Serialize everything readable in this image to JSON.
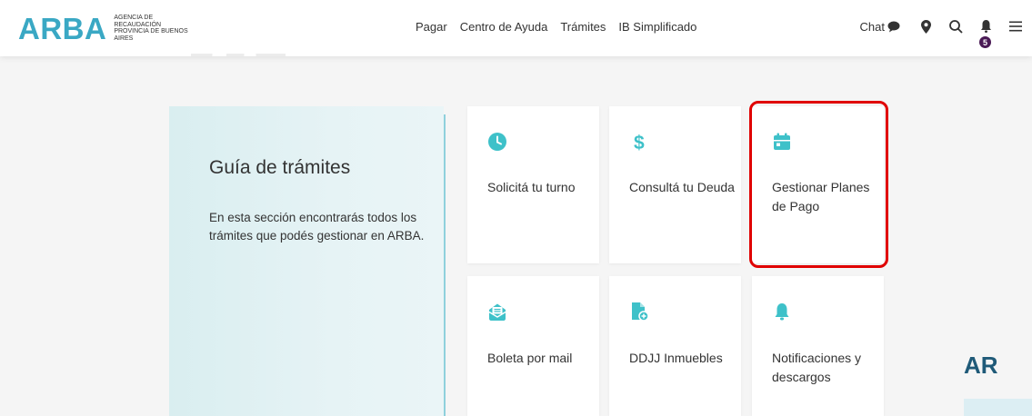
{
  "header": {
    "logo": {
      "mark": "ARBA",
      "sub": [
        "AGENCIA DE",
        "RECAUDACIÓN",
        "PROVINCIA DE BUENOS",
        "AIRES"
      ]
    },
    "nav": [
      "Pagar",
      "Centro de Ayuda",
      "Trámites",
      "IB Simplificado"
    ],
    "chat_label": "Chat",
    "notification_count": "5",
    "icons": [
      "chat-bubble-icon",
      "location-pin-icon",
      "search-icon",
      "bell-icon",
      "menu-icon"
    ]
  },
  "guide": {
    "title": "Guía de trámites",
    "description": "En esta sección encontrarás todos los trámites que podés gestionar en ARBA."
  },
  "cards": [
    {
      "label": "Solicitá tu turno",
      "icon": "clock-icon"
    },
    {
      "label": "Consultá tu Deuda",
      "icon": "dollar-icon"
    },
    {
      "label": "Gestionar Planes de Pago",
      "icon": "calendar-icon",
      "highlighted": true
    },
    {
      "label": "Boleta por mail",
      "icon": "mail-icon"
    },
    {
      "label": "DDJJ Inmuebles",
      "icon": "document-add-icon"
    },
    {
      "label": "Notificaciones y descargos",
      "icon": "bell-icon"
    }
  ],
  "peek_text": "AR",
  "colors": {
    "accent": "#3ec1c9",
    "logo": "#3aa8c4",
    "highlight": "#e00000",
    "badge": "#4a1a55"
  }
}
